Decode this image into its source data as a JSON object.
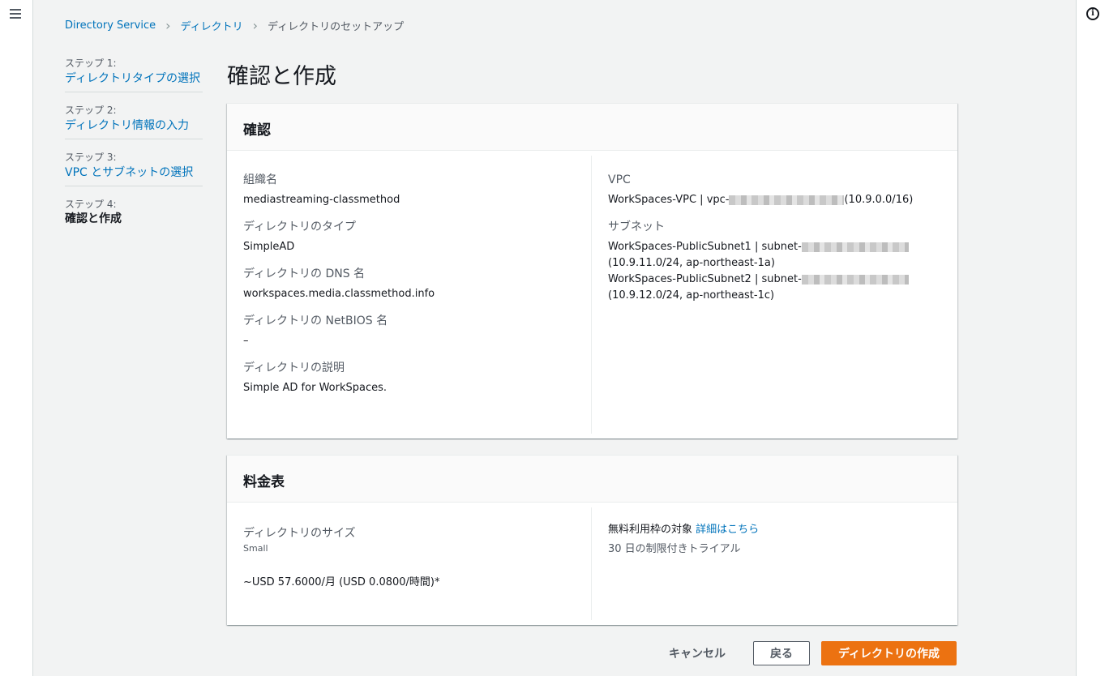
{
  "breadcrumb": {
    "items": [
      "Directory Service",
      "ディレクトリ",
      "ディレクトリのセットアップ"
    ]
  },
  "steps": [
    {
      "num": "ステップ 1:",
      "title": "ディレクトリタイプの選択"
    },
    {
      "num": "ステップ 2:",
      "title": "ディレクトリ情報の入力"
    },
    {
      "num": "ステップ 3:",
      "title": "VPC とサブネットの選択"
    },
    {
      "num": "ステップ 4:",
      "title": "確認と作成"
    }
  ],
  "page_title": "確認と作成",
  "review": {
    "header": "確認",
    "org_label": "組織名",
    "org_value": "mediastreaming-classmethod",
    "type_label": "ディレクトリのタイプ",
    "type_value": "SimpleAD",
    "dns_label": "ディレクトリの DNS 名",
    "dns_value": "workspaces.media.classmethod.info",
    "netbios_label": "ディレクトリの NetBIOS 名",
    "netbios_value": "–",
    "desc_label": "ディレクトリの説明",
    "desc_value": "Simple AD for WorkSpaces.",
    "vpc_label": "VPC",
    "vpc_prefix": "WorkSpaces-VPC | vpc-",
    "vpc_suffix": "(10.9.0.0/16)",
    "subnet_label": "サブネット",
    "subnet1_prefix": "WorkSpaces-PublicSubnet1 | subnet-",
    "subnet1_detail": "(10.9.11.0/24, ap-northeast-1a)",
    "subnet2_prefix": "WorkSpaces-PublicSubnet2 | subnet-",
    "subnet2_detail": "(10.9.12.0/24, ap-northeast-1c)"
  },
  "pricing": {
    "header": "料金表",
    "size_label": "ディレクトリのサイズ",
    "size_value": "Small",
    "price": "~USD 57.6000/月 (USD 0.0800/時間)*",
    "free_tier": "無料利用枠の対象",
    "details_link": "詳細はこちら",
    "trial": "30 日の制限付きトライアル"
  },
  "actions": {
    "cancel": "キャンセル",
    "back": "戻る",
    "create": "ディレクトリの作成"
  }
}
